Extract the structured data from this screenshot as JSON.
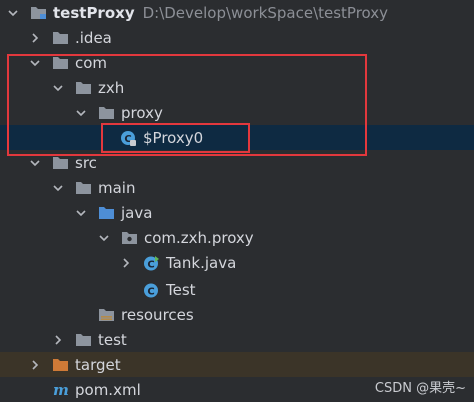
{
  "root": {
    "label": "testProxy",
    "path": "D:\\Develop\\workSpace\\testProxy"
  },
  "items": [
    {
      "label": ".idea"
    },
    {
      "label": "com"
    },
    {
      "label": "zxh"
    },
    {
      "label": "proxy"
    },
    {
      "label": "$Proxy0"
    },
    {
      "label": "src"
    },
    {
      "label": "main"
    },
    {
      "label": "java"
    },
    {
      "label": "com.zxh.proxy"
    },
    {
      "label": "Tank.java"
    },
    {
      "label": "Test"
    },
    {
      "label": "resources"
    },
    {
      "label": "test"
    },
    {
      "label": "target"
    },
    {
      "label": "pom.xml"
    }
  ],
  "watermark": "CSDN @果壳~",
  "colors": {
    "background": "#2b2d30",
    "selection": "#0e2a42",
    "folder": "#8d949e",
    "source_folder": "#4e8ed6",
    "resources_folder": "#b48b4a",
    "excluded_folder": "#cf7a37",
    "class_icon": "#4a9fdb",
    "annotation_box": "#e3383d"
  },
  "icons": [
    "module-folder-icon",
    "folder-icon",
    "source-folder-icon",
    "package-icon",
    "class-icon",
    "locked-class-icon",
    "maven-icon",
    "resources-folder-icon",
    "excluded-folder-icon",
    "chevron-right-icon",
    "chevron-down-icon"
  ]
}
